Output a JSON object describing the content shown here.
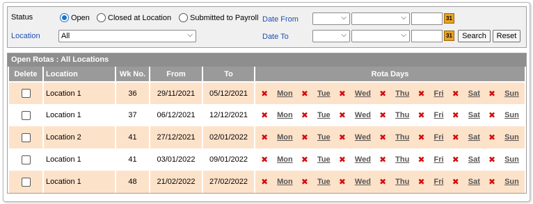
{
  "filters": {
    "status_label": "Status",
    "status_options": [
      {
        "label": "Open",
        "selected": true
      },
      {
        "label": "Closed at Location",
        "selected": false
      },
      {
        "label": "Submitted to Payroll",
        "selected": false
      }
    ],
    "location_label": "Location",
    "location_value": "All",
    "date_from_label": "Date From",
    "date_to_label": "Date To",
    "calendar_icon_text": "31",
    "search_label": "Search",
    "reset_label": "Reset"
  },
  "grid": {
    "caption": "Open Rotas : All Locations",
    "columns": [
      "Delete",
      "Location",
      "Wk No.",
      "From",
      "To",
      "Rota Days"
    ],
    "day_labels": [
      "Mon",
      "Tue",
      "Wed",
      "Thu",
      "Fri",
      "Sat",
      "Sun"
    ],
    "rows": [
      {
        "location": "Location 1",
        "wk": "36",
        "from": "29/11/2021",
        "to": "05/12/2021"
      },
      {
        "location": "Location 1",
        "wk": "37",
        "from": "06/12/2021",
        "to": "12/12/2021"
      },
      {
        "location": "Location 2",
        "wk": "41",
        "from": "27/12/2021",
        "to": "02/01/2022"
      },
      {
        "location": "Location 1",
        "wk": "41",
        "from": "03/01/2022",
        "to": "09/01/2022"
      },
      {
        "location": "Location 1",
        "wk": "48",
        "from": "21/02/2022",
        "to": "27/02/2022"
      }
    ]
  },
  "colors": {
    "row_highlight": "#fde2ca",
    "header_grey": "#9a9a9a",
    "label_blue": "#1f4fb4",
    "delete_red": "#d01010"
  }
}
